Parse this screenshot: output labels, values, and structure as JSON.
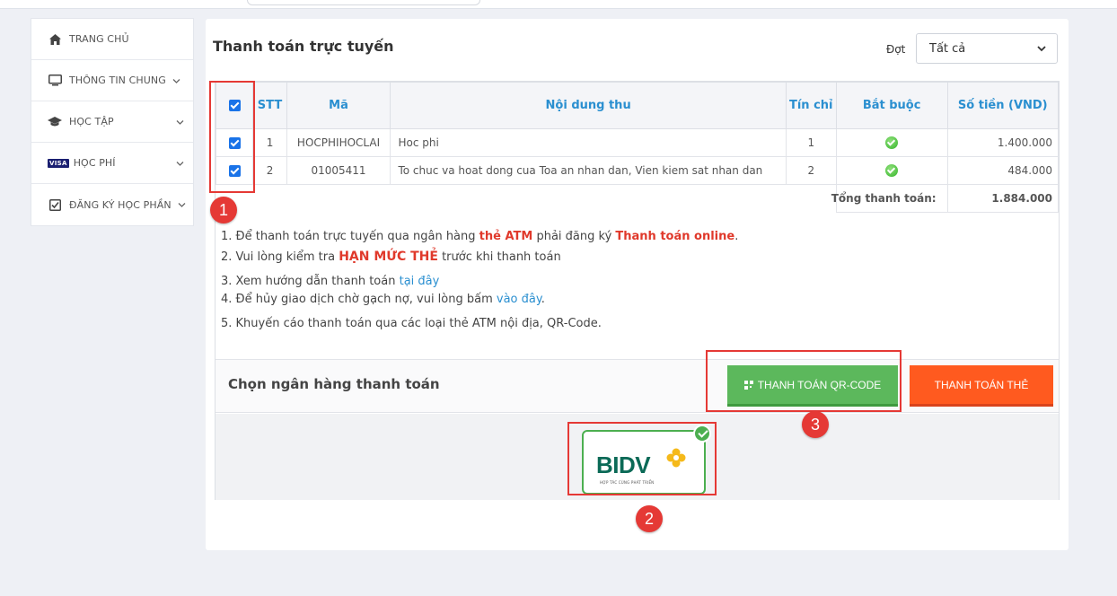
{
  "sidebar": {
    "items": [
      {
        "label": "TRANG CHỦ",
        "icon": "home-icon"
      },
      {
        "label": "THÔNG TIN CHUNG",
        "icon": "monitor-icon"
      },
      {
        "label": "HỌC TẬP",
        "icon": "graduation-cap-icon"
      },
      {
        "label": "HỌC PHÍ",
        "icon": "visa-card-icon",
        "icon_text": "VISA"
      },
      {
        "label": "ĐĂNG KÝ HỌC PHẦN",
        "icon": "checkbox-icon"
      }
    ]
  },
  "main": {
    "title": "Thanh toán trực tuyến",
    "filter": {
      "label": "Đợt",
      "value": "Tất cả"
    },
    "table": {
      "headers": [
        "STT",
        "Mã",
        "Nội dung thu",
        "Tín chỉ",
        "Bắt buộc",
        "Số tiền (VND)"
      ],
      "rows": [
        {
          "stt": "1",
          "ma": "HOCPHIHOCLAI",
          "noi_dung": "Hoc phi",
          "tin_chi": "1",
          "amount": "1.400.000"
        },
        {
          "stt": "2",
          "ma": "01005411",
          "noi_dung": "To chuc va hoat dong cua Toa an nhan dan, Vien kiem sat nhan dan",
          "tin_chi": "2",
          "amount": "484.000"
        }
      ],
      "total_label": "Tổng thanh toán:",
      "total_value": "1.884.000"
    },
    "notes": {
      "n1_a": "1. Để thanh toán trực tuyến qua ngân hàng ",
      "n1_b": "thẻ ATM",
      "n1_c": " phải đăng ký ",
      "n1_d": "Thanh toán online",
      "n1_e": ".",
      "n2_a": "2. Vui lòng kiểm tra ",
      "n2_b": "HẠN MỨC THẺ",
      "n2_c": " trước khi thanh toán",
      "n3_a": "3. Xem hướng dẫn thanh toán ",
      "n3_link": "tại đây",
      "n4_a": "4. Để hủy giao dịch chờ gạch nợ, vui lòng bấm ",
      "n4_link": "vào đây",
      "n4_b": ".",
      "n5": "5. Khuyến cáo thanh toán qua các loại thẻ ATM nội địa, QR-Code."
    },
    "bank": {
      "title": "Chọn ngân hàng thanh toán",
      "qr_button": "THANH TOÁN QR-CODE",
      "card_button": "THANH TOÁN THẺ",
      "logo_text": "BIDV",
      "logo_slogan": "HỢP TÁC CÙNG PHÁT TRIỂN"
    }
  },
  "annotations": {
    "markers": [
      "1",
      "2",
      "3"
    ],
    "highlight_color": "#e53935"
  },
  "colors": {
    "accent_blue": "#2a8fd0",
    "qr_green": "#5cb85c",
    "card_orange": "#ff5a1f",
    "alert_red": "#e0392b"
  }
}
